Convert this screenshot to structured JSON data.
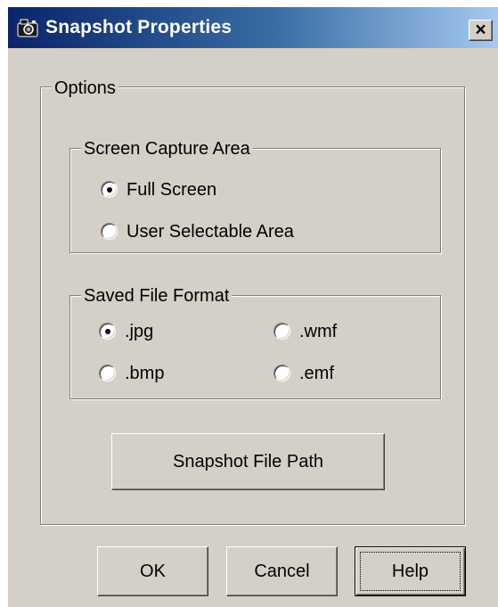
{
  "window": {
    "title": "Snapshot Properties",
    "icon": "camera-icon",
    "close_glyph": "×"
  },
  "options_group": {
    "label": "Options"
  },
  "capture_area": {
    "label": "Screen Capture Area",
    "options": [
      {
        "label": "Full Screen",
        "selected": true
      },
      {
        "label": "User Selectable Area",
        "selected": false
      }
    ]
  },
  "file_format": {
    "label": "Saved File Format",
    "options": [
      {
        "label": ".jpg",
        "selected": true
      },
      {
        "label": ".wmf",
        "selected": false
      },
      {
        "label": ".bmp",
        "selected": false
      },
      {
        "label": ".emf",
        "selected": false
      }
    ]
  },
  "buttons": {
    "snapshot_path": "Snapshot File Path",
    "ok": "OK",
    "cancel": "Cancel",
    "help": "Help"
  },
  "colors": {
    "dialog_face": "#d4d0c8",
    "title_start": "#0a246a",
    "title_end": "#a6caf0"
  }
}
